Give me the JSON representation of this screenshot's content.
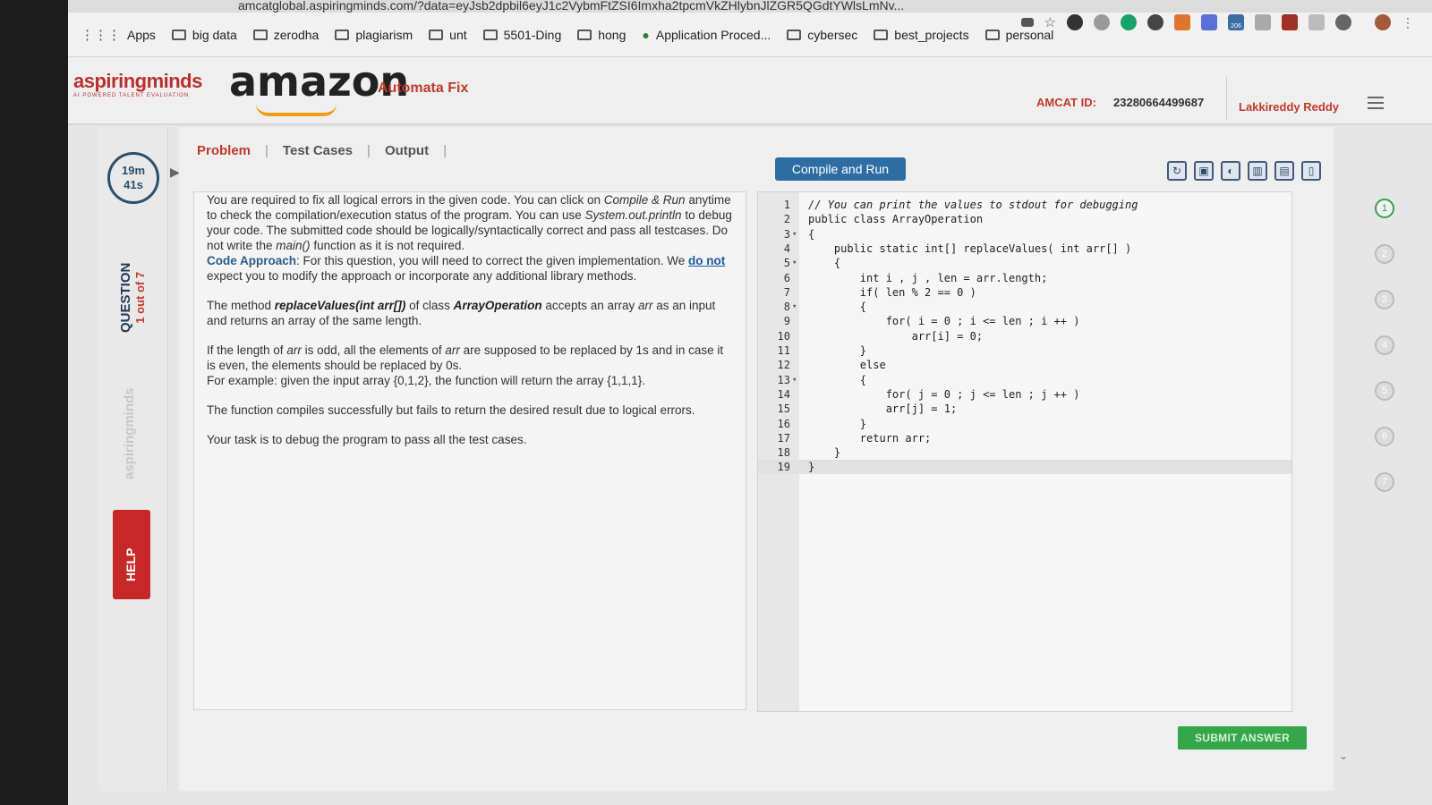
{
  "browser": {
    "url": "amcatglobal.aspiringminds.com/?data=eyJsb2dpbil6eyJ1c2VybmFtZSI6Imxha2tpcmVkZHlybnJlZGR5QGdtYWlsLmNv...",
    "bookmarks": [
      {
        "label": "Apps",
        "icon": "apps-grid-icon"
      },
      {
        "label": "big data",
        "icon": "folder-icon"
      },
      {
        "label": "zerodha",
        "icon": "folder-icon"
      },
      {
        "label": "plagiarism",
        "icon": "folder-icon"
      },
      {
        "label": "unt",
        "icon": "folder-icon"
      },
      {
        "label": "5501-Ding",
        "icon": "folder-icon"
      },
      {
        "label": "hong",
        "icon": "folder-icon"
      },
      {
        "label": "Application Proced...",
        "icon": "globe-icon"
      },
      {
        "label": "cybersec",
        "icon": "folder-icon"
      },
      {
        "label": "best_projects",
        "icon": "folder-icon"
      },
      {
        "label": "personal",
        "icon": "folder-icon"
      }
    ],
    "extension_badge": "206"
  },
  "header": {
    "brand": "aspiringminds",
    "brand_tagline": "AI POWERED TALENT EVALUATION",
    "partner": "amazon",
    "app_title": "Automata Fix",
    "amcat_label": "AMCAT ID:",
    "amcat_id": "23280664499687",
    "user_name": "Lakkireddy Reddy"
  },
  "left_rail": {
    "timer_minutes": "19m",
    "timer_seconds": "41s",
    "question_label": "QUESTION",
    "question_count": "1 out of 7",
    "brand_watermark": "aspiringminds",
    "help_label": "HELP"
  },
  "tabs": [
    {
      "label": "Problem",
      "active": true
    },
    {
      "label": "Test Cases",
      "active": false
    },
    {
      "label": "Output",
      "active": false
    }
  ],
  "problem": {
    "p1_a": "You are required to fix all logical errors in the given code. You can click on ",
    "p1_compile": "Compile & Run",
    "p1_b": " anytime to check the compilation/execution status of the program. You can use ",
    "p1_sysout": "System.out.println",
    "p1_c": " to debug your code. The submitted code should be logically/syntactically correct and pass all testcases. Do not write the ",
    "p1_main": "main()",
    "p1_d": " function as it is not required.",
    "approach_label": "Code Approach",
    "approach_a": ": For this question, you will need to correct the given implementation. We ",
    "approach_do_not": "do not",
    "approach_b": " expect you to modify the approach or incorporate any additional library methods.",
    "p2_a": "The method ",
    "p2_method": "replaceValues(int arr[])",
    "p2_b": " of class ",
    "p2_class": "ArrayOperation",
    "p2_c": " accepts an array ",
    "p2_arr": "arr",
    "p2_d": " as an input and returns an array of the same length.",
    "p3_a": "If the length of ",
    "p3_arr1": "arr",
    "p3_b": " is odd, all the elements of ",
    "p3_arr2": "arr",
    "p3_c": " are supposed to be replaced by 1s and in case it is even, the elements should be replaced by 0s.",
    "p3_example": "For example: given the input array {0,1,2}, the function will return the array {1,1,1}.",
    "p4": "The function compiles successfully but fails to return the desired result due to logical errors.",
    "p5": "Your task is to debug the program to pass all the test cases."
  },
  "editor": {
    "compile_button": "Compile and Run",
    "tools": [
      "reset-icon",
      "save-icon",
      "theme-icon",
      "layout-split-icon",
      "layout-bottom-icon",
      "layout-side-icon"
    ],
    "lines": [
      {
        "n": "1",
        "fold": "",
        "text": "// You can print the values to stdout for debugging"
      },
      {
        "n": "2",
        "fold": "",
        "text": "public class ArrayOperation"
      },
      {
        "n": "3",
        "fold": "▾",
        "text": "{"
      },
      {
        "n": "4",
        "fold": "",
        "text": "    public static int[] replaceValues( int arr[] )"
      },
      {
        "n": "5",
        "fold": "▾",
        "text": "    {"
      },
      {
        "n": "6",
        "fold": "",
        "text": "        int i , j , len = arr.length;"
      },
      {
        "n": "7",
        "fold": "",
        "text": "        if( len % 2 == 0 )"
      },
      {
        "n": "8",
        "fold": "▾",
        "text": "        {"
      },
      {
        "n": "9",
        "fold": "",
        "text": "            for( i = 0 ; i <= len ; i ++ )"
      },
      {
        "n": "10",
        "fold": "",
        "text": "                arr[i] = 0;"
      },
      {
        "n": "11",
        "fold": "",
        "text": "        }"
      },
      {
        "n": "12",
        "fold": "",
        "text": "        else"
      },
      {
        "n": "13",
        "fold": "▾",
        "text": "        {"
      },
      {
        "n": "14",
        "fold": "",
        "text": "            for( j = 0 ; j <= len ; j ++ )"
      },
      {
        "n": "15",
        "fold": "",
        "text": "            arr[j] = 1;"
      },
      {
        "n": "16",
        "fold": "",
        "text": "        }"
      },
      {
        "n": "17",
        "fold": "",
        "text": "        return arr;"
      },
      {
        "n": "18",
        "fold": "",
        "text": "    }"
      },
      {
        "n": "19",
        "fold": "",
        "text": "}"
      }
    ],
    "current_line": "19"
  },
  "question_nav": [
    "1",
    "2",
    "3",
    "4",
    "5",
    "6",
    "7"
  ],
  "submit_button": "SUBMIT ANSWER",
  "colors": {
    "accent_red": "#c0392b",
    "compile_blue": "#2d6da4",
    "submit_green": "#35a64a"
  }
}
